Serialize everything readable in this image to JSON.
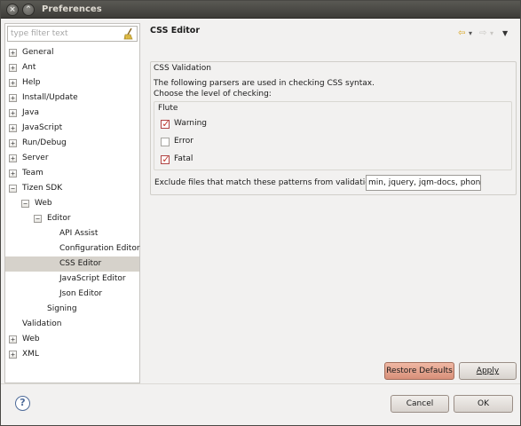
{
  "window": {
    "title": "Preferences"
  },
  "filter": {
    "placeholder": "type filter text"
  },
  "tree": [
    {
      "label": "General",
      "toggle": "+",
      "level": 0
    },
    {
      "label": "Ant",
      "toggle": "+",
      "level": 0
    },
    {
      "label": "Help",
      "toggle": "+",
      "level": 0
    },
    {
      "label": "Install/Update",
      "toggle": "+",
      "level": 0
    },
    {
      "label": "Java",
      "toggle": "+",
      "level": 0
    },
    {
      "label": "JavaScript",
      "toggle": "+",
      "level": 0
    },
    {
      "label": "Run/Debug",
      "toggle": "+",
      "level": 0
    },
    {
      "label": "Server",
      "toggle": "+",
      "level": 0
    },
    {
      "label": "Team",
      "toggle": "+",
      "level": 0
    },
    {
      "label": "Tizen SDK",
      "toggle": "−",
      "level": 0
    },
    {
      "label": "Web",
      "toggle": "−",
      "level": 1
    },
    {
      "label": "Editor",
      "toggle": "−",
      "level": 2
    },
    {
      "label": "API Assist",
      "toggle": "",
      "level": 3
    },
    {
      "label": "Configuration Editor",
      "toggle": "",
      "level": 3
    },
    {
      "label": "CSS Editor",
      "toggle": "",
      "level": 3,
      "selected": true
    },
    {
      "label": "JavaScript Editor",
      "toggle": "",
      "level": 3
    },
    {
      "label": "Json Editor",
      "toggle": "",
      "level": 3
    },
    {
      "label": "Signing",
      "toggle": "",
      "level": 2
    },
    {
      "label": "Validation",
      "toggle": "",
      "level": 0
    },
    {
      "label": "Web",
      "toggle": "+",
      "level": 0
    },
    {
      "label": "XML",
      "toggle": "+",
      "level": 0
    }
  ],
  "page": {
    "title": "CSS Editor",
    "nav_back": "⇦",
    "nav_back_menu": "▾",
    "nav_forward": "⇨",
    "nav_forward_menu": "▾",
    "view_menu": "▼"
  },
  "validation": {
    "group_title": "CSS Validation",
    "desc_line1": "The following parsers are used in checking CSS syntax.",
    "desc_line2": "Choose the level of checking:",
    "parser_name": "Flute",
    "levels": [
      {
        "label": "Warning",
        "checked": true
      },
      {
        "label": "Error",
        "checked": false
      },
      {
        "label": "Fatal",
        "checked": true
      }
    ],
    "exclude_label": "Exclude files that match these patterns from validation:",
    "exclude_value": "min, jquery, jqm-docs, phonegap"
  },
  "buttons": {
    "restore_defaults": "Restore Defaults",
    "apply": "Apply",
    "cancel": "Cancel",
    "ok": "OK"
  },
  "colors": {
    "accent_button": "#d88f79",
    "check_mark": "#c0392b",
    "selection": "#d6d2cb"
  }
}
